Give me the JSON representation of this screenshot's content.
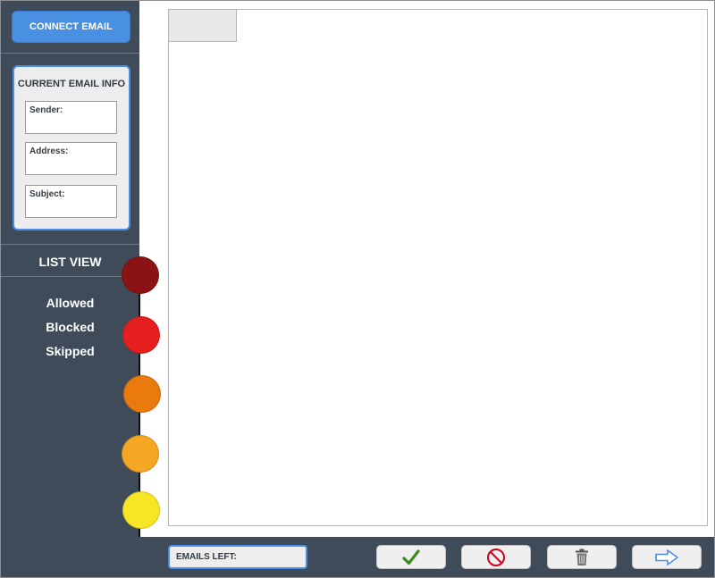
{
  "sidebar": {
    "connect_label": "CONNECT EMAIL",
    "email_info": {
      "title": "CURRENT EMAIL INFO",
      "sender_label": "Sender:",
      "address_label": "Address:",
      "subject_label": "Subject:"
    },
    "list_view": {
      "title": "LIST VIEW",
      "items": [
        "Allowed",
        "Blocked",
        "Skipped"
      ]
    }
  },
  "timeline": {
    "colors": [
      "#8b1313",
      "#e51f1f",
      "#ea7a0e",
      "#f5a623",
      "#f7e625"
    ]
  },
  "bottom_bar": {
    "emails_left_label": "EMAILS LEFT:",
    "actions": {
      "allow_icon": "checkmark-icon",
      "block_icon": "prohibited-icon",
      "delete_icon": "trash-icon",
      "skip_icon": "arrow-right-icon"
    }
  },
  "theme": {
    "accent": "#4a90e2",
    "panel": "#3f4b59",
    "check_green": "#3b8a1f",
    "block_red": "#d0021b",
    "trash_gray": "#666666"
  }
}
